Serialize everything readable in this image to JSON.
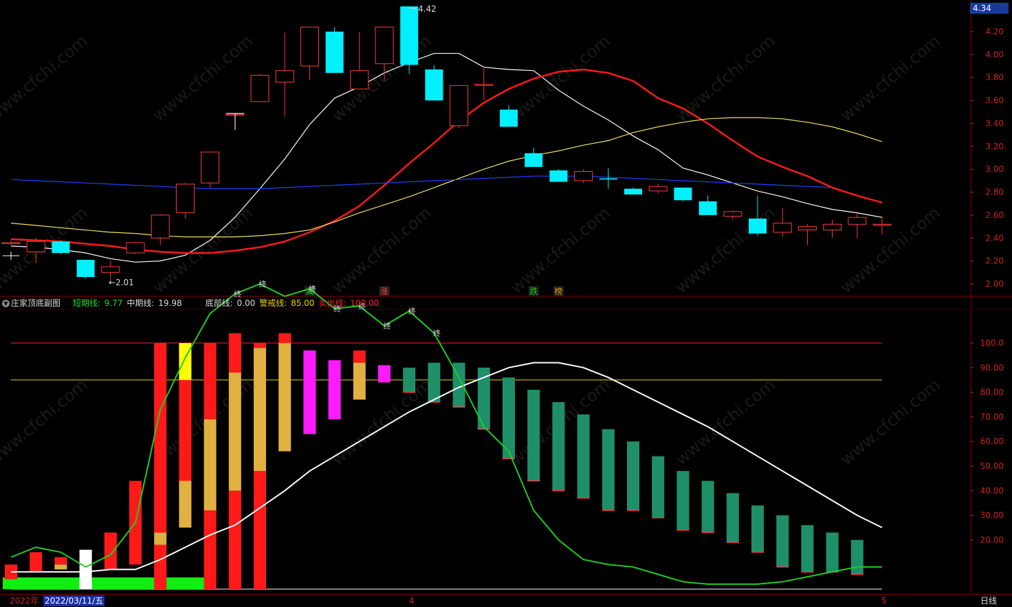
{
  "price_panel": {
    "current_price": "4.34",
    "high_label": "4.42",
    "low_label": "←2.01",
    "y_ticks": [
      "4.20",
      "4.00",
      "3.80",
      "3.60",
      "3.40",
      "3.20",
      "3.00",
      "2.80",
      "2.60",
      "2.40",
      "2.20",
      "2.00"
    ],
    "markers": [
      {
        "text": "减",
        "color": "#22cc22",
        "candle": 12
      },
      {
        "text": "涨",
        "color": "#ff4444",
        "candle": 15
      },
      {
        "text": "跌",
        "color": "#22cc22",
        "candle": 21
      },
      {
        "text": "榜",
        "color": "#e09a2a",
        "candle": 22
      }
    ]
  },
  "sub_panel": {
    "title": "庄家顶底副图",
    "legend": [
      {
        "label": "短期线: ",
        "value": "9.77",
        "color": "#22dd22",
        "value_color": "#22dd22"
      },
      {
        "label": "中期线: ",
        "value": "19.98",
        "color": "#dddddd",
        "value_color": "#dddddd"
      },
      {
        "label": "底部线: ",
        "value": "0.00",
        "color": "#dddddd",
        "value_color": "#dddddd"
      },
      {
        "label": "警戒线: ",
        "value": "85.00",
        "color": "#e8d600",
        "value_color": "#e8d600"
      },
      {
        "label": "卖出线: ",
        "value": "100.00",
        "color": "#ff2222",
        "value_color": "#ff2222"
      }
    ],
    "y_ticks": [
      "100.0",
      "90.00",
      "80.00",
      "70.00",
      "60.00",
      "50.00",
      "40.00",
      "30.00",
      "20.00"
    ],
    "end_marker": "终"
  },
  "bottom_bar": {
    "year": "2022年",
    "date": "2022/03/11/五",
    "month_4": "4",
    "month_5": "5",
    "period": "日线"
  },
  "colors": {
    "up": "#ff3a3a",
    "down": "#00f0ff",
    "ma5": "#ffffff",
    "ma10": "#ff1a1a",
    "ma20": "#f0e060",
    "ma60": "#2040ff",
    "short": "#22cc22",
    "mid": "#ffffff",
    "teal": "#1f8f6a",
    "gold": "#e0b040",
    "magenta": "#ff1aff"
  },
  "chart_data": [
    {
      "type": "candlestick",
      "ylim": [
        1.92,
        4.42
      ],
      "candles": [
        {
          "o": 2.36,
          "c": 2.36,
          "h": 2.38,
          "l": 2.34
        },
        {
          "o": 2.28,
          "c": 2.37,
          "h": 2.4,
          "l": 2.18
        },
        {
          "o": 2.37,
          "c": 2.27,
          "h": 2.38,
          "l": 2.26
        },
        {
          "o": 2.21,
          "c": 2.06,
          "h": 2.21,
          "l": 2.05
        },
        {
          "o": 2.1,
          "c": 2.15,
          "h": 2.2,
          "l": 2.01
        },
        {
          "o": 2.27,
          "c": 2.36,
          "h": 2.37,
          "l": 2.26
        },
        {
          "o": 2.4,
          "c": 2.6,
          "h": 2.61,
          "l": 2.34
        },
        {
          "o": 2.62,
          "c": 2.87,
          "h": 2.88,
          "l": 2.57
        },
        {
          "o": 2.88,
          "c": 3.15,
          "h": 3.15,
          "l": 2.84
        },
        {
          "o": 3.48,
          "c": 3.48,
          "h": 3.48,
          "l": 3.34
        },
        {
          "o": 3.59,
          "c": 3.82,
          "h": 3.83,
          "l": 3.59
        },
        {
          "o": 3.76,
          "c": 3.86,
          "h": 4.19,
          "l": 3.46
        },
        {
          "o": 3.9,
          "c": 4.24,
          "h": 4.24,
          "l": 3.78
        },
        {
          "o": 4.2,
          "c": 3.84,
          "h": 4.24,
          "l": 3.84
        },
        {
          "o": 3.7,
          "c": 3.86,
          "h": 4.2,
          "l": 3.7
        },
        {
          "o": 3.92,
          "c": 4.24,
          "h": 4.24,
          "l": 3.77
        },
        {
          "o": 4.42,
          "c": 3.91,
          "h": 4.42,
          "l": 3.83
        },
        {
          "o": 3.87,
          "c": 3.6,
          "h": 3.91,
          "l": 3.6
        },
        {
          "o": 3.38,
          "c": 3.73,
          "h": 3.73,
          "l": 3.36
        },
        {
          "o": 3.74,
          "c": 3.74,
          "h": 3.88,
          "l": 3.6
        },
        {
          "o": 3.52,
          "c": 3.37,
          "h": 3.56,
          "l": 3.37
        },
        {
          "o": 3.14,
          "c": 3.02,
          "h": 3.19,
          "l": 3.02
        },
        {
          "o": 2.99,
          "c": 2.89,
          "h": 3.0,
          "l": 2.89
        },
        {
          "o": 2.9,
          "c": 2.98,
          "h": 3.0,
          "l": 2.88
        },
        {
          "o": 2.92,
          "c": 2.91,
          "h": 3.01,
          "l": 2.83
        },
        {
          "o": 2.83,
          "c": 2.78,
          "h": 2.84,
          "l": 2.78
        },
        {
          "o": 2.81,
          "c": 2.85,
          "h": 2.87,
          "l": 2.79
        },
        {
          "o": 2.84,
          "c": 2.73,
          "h": 2.84,
          "l": 2.72
        },
        {
          "o": 2.72,
          "c": 2.6,
          "h": 2.77,
          "l": 2.6
        },
        {
          "o": 2.59,
          "c": 2.63,
          "h": 2.64,
          "l": 2.56
        },
        {
          "o": 2.57,
          "c": 2.44,
          "h": 2.77,
          "l": 2.42
        },
        {
          "o": 2.45,
          "c": 2.53,
          "h": 2.66,
          "l": 2.41
        },
        {
          "o": 2.47,
          "c": 2.5,
          "h": 2.52,
          "l": 2.34
        },
        {
          "o": 2.47,
          "c": 2.52,
          "h": 2.56,
          "l": 2.4
        },
        {
          "o": 2.52,
          "c": 2.58,
          "h": 2.63,
          "l": 2.4
        },
        {
          "o": 2.52,
          "c": 2.52,
          "h": 2.59,
          "l": 2.43
        }
      ],
      "ma": [
        {
          "name": "MA5",
          "color": "#ffffff",
          "values": [
            2.33,
            2.32,
            2.3,
            2.27,
            2.22,
            2.19,
            2.2,
            2.25,
            2.38,
            2.58,
            2.83,
            3.09,
            3.39,
            3.62,
            3.72,
            3.84,
            3.93,
            4.01,
            4.01,
            3.89,
            3.87,
            3.86,
            3.69,
            3.55,
            3.43,
            3.29,
            3.17,
            3.01,
            2.95,
            2.88,
            2.81,
            2.76,
            2.7,
            2.65,
            2.62,
            2.58,
            2.54,
            2.52,
            2.53,
            2.53
          ]
        },
        {
          "name": "MA10",
          "color": "#ff1a1a",
          "values": [
            2.39,
            2.38,
            2.37,
            2.35,
            2.33,
            2.3,
            2.28,
            2.27,
            2.27,
            2.29,
            2.32,
            2.37,
            2.45,
            2.55,
            2.68,
            2.86,
            3.05,
            3.23,
            3.42,
            3.58,
            3.7,
            3.79,
            3.85,
            3.87,
            3.84,
            3.77,
            3.62,
            3.53,
            3.4,
            3.25,
            3.11,
            3.02,
            2.94,
            2.84,
            2.77,
            2.71,
            2.67,
            2.64,
            2.62,
            2.6,
            2.58
          ]
        },
        {
          "name": "MA20",
          "color": "#f0e060",
          "values": [
            2.53,
            2.51,
            2.49,
            2.47,
            2.45,
            2.44,
            2.42,
            2.41,
            2.41,
            2.41,
            2.42,
            2.44,
            2.47,
            2.54,
            2.62,
            2.69,
            2.76,
            2.84,
            2.92,
            3.0,
            3.07,
            3.12,
            3.16,
            3.21,
            3.25,
            3.32,
            3.37,
            3.41,
            3.44,
            3.45,
            3.45,
            3.44,
            3.41,
            3.37,
            3.31,
            3.24,
            3.15,
            3.08,
            3.04,
            3.0,
            2.94
          ]
        },
        {
          "name": "MA60",
          "color": "#2040ff",
          "values": [
            2.91,
            2.9,
            2.89,
            2.88,
            2.87,
            2.86,
            2.85,
            2.84,
            2.83,
            2.83,
            2.83,
            2.84,
            2.85,
            2.86,
            2.87,
            2.88,
            2.89,
            2.9,
            2.91,
            2.92,
            2.93,
            2.94,
            2.94,
            2.94,
            2.93,
            2.92,
            2.91,
            2.9,
            2.89,
            2.88,
            2.87,
            2.86,
            2.85,
            2.84
          ]
        }
      ]
    },
    {
      "type": "bar",
      "title": "庄家顶底副图",
      "ylim": [
        -15,
        116
      ],
      "reference_lines": [
        {
          "name": "卖出线",
          "value": 100,
          "color": "#ff2222"
        },
        {
          "name": "警戒线",
          "value": 85,
          "color": "#e8d600"
        },
        {
          "name": "底部线",
          "value": 0,
          "color": "#ffffff"
        }
      ],
      "mid_line": [
        7,
        7,
        7,
        7,
        8,
        8,
        12,
        17,
        22,
        26,
        33,
        40,
        48,
        54,
        60,
        66,
        72,
        77,
        82,
        86,
        90,
        92,
        92,
        90,
        86,
        81,
        76,
        71,
        66,
        60,
        54,
        48,
        42,
        36,
        30,
        25,
        21,
        18,
        15,
        12,
        10
      ],
      "short_line": [
        13,
        17,
        15,
        9,
        14,
        27,
        73,
        94,
        112,
        120,
        124,
        119,
        122,
        114,
        115,
        107,
        113,
        104,
        86,
        66,
        56,
        32,
        20,
        12,
        10,
        9,
        6,
        3,
        2,
        2,
        2,
        3,
        5,
        7,
        9,
        9
      ],
      "bars": [
        {
          "segments": [
            {
              "from": 4,
              "to": 10,
              "color": "#ff1a1a"
            }
          ]
        },
        {
          "segments": [
            {
              "from": 7,
              "to": 15,
              "color": "#ff1a1a"
            }
          ]
        },
        {
          "segments": [
            {
              "from": 8,
              "to": 10,
              "color": "#e0b040"
            },
            {
              "from": 10,
              "to": 13,
              "color": "#ff1a1a"
            }
          ]
        },
        {
          "segments": [
            {
              "from": 0,
              "to": 16,
              "color": "#ffffff"
            }
          ]
        },
        {
          "segments": [
            {
              "from": 8,
              "to": 23,
              "color": "#ff1a1a"
            }
          ]
        },
        {
          "segments": [
            {
              "from": 10,
              "to": 44,
              "color": "#ff1a1a"
            }
          ]
        },
        {
          "segments": [
            {
              "from": 18,
              "to": 23,
              "color": "#e0b040"
            },
            {
              "from": 0,
              "to": 18,
              "color": "#ff1a1a"
            },
            {
              "from": 23,
              "to": 100,
              "color": "#ff1a1a"
            }
          ]
        },
        {
          "segments": [
            {
              "from": 25,
              "to": 44,
              "color": "#e0b040"
            },
            {
              "from": 44,
              "to": 85,
              "color": "#ff1a1a"
            },
            {
              "from": 85,
              "to": 100,
              "color": "#ffff00"
            }
          ]
        },
        {
          "segments": [
            {
              "from": 0,
              "to": 32,
              "color": "#ff1a1a"
            },
            {
              "from": 32,
              "to": 69,
              "color": "#e0b040"
            },
            {
              "from": 69,
              "to": 100,
              "color": "#ff1a1a"
            }
          ]
        },
        {
          "segments": [
            {
              "from": 0,
              "to": 40,
              "color": "#ff1a1a"
            },
            {
              "from": 40,
              "to": 88,
              "color": "#e0b040"
            },
            {
              "from": 88,
              "to": 104,
              "color": "#ff1a1a"
            }
          ]
        },
        {
          "segments": [
            {
              "from": 0,
              "to": 48,
              "color": "#ff1a1a"
            },
            {
              "from": 48,
              "to": 98,
              "color": "#e0b040"
            },
            {
              "from": 98,
              "to": 100,
              "color": "#ff1a1a"
            }
          ]
        },
        {
          "segments": [
            {
              "from": 56,
              "to": 100,
              "color": "#e0b040"
            },
            {
              "from": 100,
              "to": 104,
              "color": "#ff1a1a"
            }
          ]
        },
        {
          "segments": [
            {
              "from": 63,
              "to": 97,
              "color": "#ff1aff"
            }
          ]
        },
        {
          "segments": [
            {
              "from": 69,
              "to": 93,
              "color": "#ff1aff"
            }
          ]
        },
        {
          "segments": [
            {
              "from": 77,
              "to": 92,
              "color": "#e0b040"
            },
            {
              "from": 92,
              "to": 97,
              "color": "#ff1a1a"
            }
          ]
        },
        {
          "segments": [
            {
              "from": 84,
              "to": 91,
              "color": "#ff1aff"
            }
          ]
        },
        {
          "segments": [
            {
              "from": 80,
              "to": 90,
              "color": "#1f8f6a"
            }
          ]
        },
        {
          "segments": [
            {
              "from": 76,
              "to": 92,
              "color": "#1f8f6a"
            }
          ]
        },
        {
          "segments": [
            {
              "from": 74,
              "to": 92,
              "color": "#1f8f6a"
            }
          ]
        },
        {
          "segments": [
            {
              "from": 65,
              "to": 90,
              "color": "#1f8f6a"
            }
          ]
        },
        {
          "segments": [
            {
              "from": 53,
              "to": 86,
              "color": "#1f8f6a"
            }
          ]
        },
        {
          "segments": [
            {
              "from": 44,
              "to": 81,
              "color": "#1f8f6a"
            }
          ]
        },
        {
          "segments": [
            {
              "from": 40,
              "to": 76,
              "color": "#1f8f6a"
            }
          ]
        },
        {
          "segments": [
            {
              "from": 37,
              "to": 71,
              "color": "#1f8f6a"
            }
          ]
        },
        {
          "segments": [
            {
              "from": 32,
              "to": 65,
              "color": "#1f8f6a"
            }
          ]
        },
        {
          "segments": [
            {
              "from": 32,
              "to": 60,
              "color": "#1f8f6a"
            }
          ]
        },
        {
          "segments": [
            {
              "from": 29,
              "to": 54,
              "color": "#1f8f6a"
            }
          ]
        },
        {
          "segments": [
            {
              "from": 24,
              "to": 48,
              "color": "#1f8f6a"
            }
          ]
        },
        {
          "segments": [
            {
              "from": 23,
              "to": 44,
              "color": "#1f8f6a"
            }
          ]
        },
        {
          "segments": [
            {
              "from": 19,
              "to": 39,
              "color": "#1f8f6a"
            }
          ]
        },
        {
          "segments": [
            {
              "from": 15,
              "to": 34,
              "color": "#1f8f6a"
            }
          ]
        },
        {
          "segments": [
            {
              "from": 9,
              "to": 30,
              "color": "#1f8f6a"
            }
          ]
        },
        {
          "segments": [
            {
              "from": 7,
              "to": 26,
              "color": "#1f8f6a"
            }
          ]
        },
        {
          "segments": [
            {
              "from": 7,
              "to": 23,
              "color": "#1f8f6a"
            }
          ]
        },
        {
          "segments": [
            {
              "from": 6,
              "to": 20,
              "color": "#1f8f6a"
            }
          ]
        }
      ],
      "green_base_bars": 8
    }
  ]
}
